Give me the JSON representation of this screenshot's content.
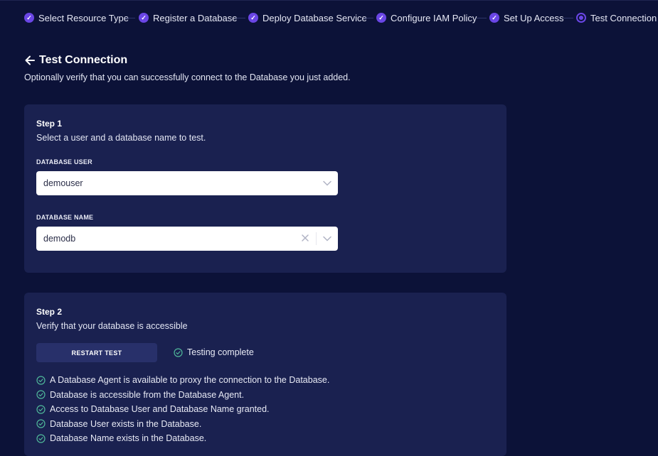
{
  "stepper": {
    "steps": [
      {
        "label": "Select Resource Type",
        "state": "done"
      },
      {
        "label": "Register a Database",
        "state": "done"
      },
      {
        "label": "Deploy Database Service",
        "state": "done"
      },
      {
        "label": "Configure IAM Policy",
        "state": "done"
      },
      {
        "label": "Set Up Access",
        "state": "done"
      },
      {
        "label": "Test Connection",
        "state": "current"
      }
    ]
  },
  "header": {
    "title": "Test Connection",
    "subtitle": "Optionally verify that you can successfully connect to the Database you just added."
  },
  "step1": {
    "title": "Step 1",
    "description": "Select a user and a database name to test.",
    "user_label": "DATABASE USER",
    "user_value": "demouser",
    "name_label": "DATABASE NAME",
    "name_value": "demodb"
  },
  "step2": {
    "title": "Step 2",
    "description": "Verify that your database is accessible",
    "restart_label": "RESTART TEST",
    "status": "Testing complete",
    "checks": [
      "A Database Agent is available to proxy the connection to the Database.",
      "Database is accessible from the Database Agent.",
      "Access to Database User and Database Name granted.",
      "Database User exists in the Database.",
      "Database Name exists in the Database."
    ]
  },
  "colors": {
    "background": "#0c1238",
    "card": "#1a2150",
    "accent": "#6a46e5",
    "success": "#4fb89a"
  },
  "icons": {
    "step_done": "check-circle-icon",
    "step_current": "radio-dot-icon",
    "back": "arrow-left-icon",
    "dropdown": "chevron-down-icon",
    "clear": "close-icon",
    "success": "check-circle-outline-icon"
  }
}
